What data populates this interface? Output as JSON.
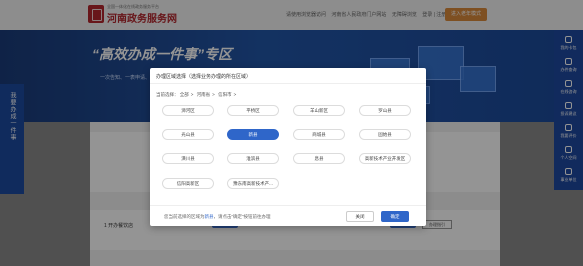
{
  "header": {
    "site_subtitle": "全国一体化在线政务服务平台",
    "site_title": "河南政务服务网",
    "links": [
      "请使用浏览器访问",
      "河南省人民政府门户网站",
      "无障碍浏览",
      "登录 | 注册"
    ],
    "login_button": "进入老年模式"
  },
  "banner": {
    "title": "“高效办成一件事”专区",
    "subtitle": "一次告知、一表申请、一套材料、一次办好"
  },
  "left_float": {
    "text": "我要办成一件事"
  },
  "right_bar": {
    "items": [
      "我的卡包",
      "办件查询",
      "在线咨询",
      "投诉建议",
      "我要评价",
      "个人空间",
      "事业单位"
    ]
  },
  "page": {
    "step_text": "1 开办餐饮店",
    "side_button": "办理指引"
  },
  "modal": {
    "title": "办理区域选择（选择业务办理的所在区域）",
    "breadcrumb": {
      "label": "当前选择：",
      "items": [
        "全部",
        "河南省",
        "信阳市"
      ]
    },
    "chips": [
      "浉河区",
      "平桥区",
      "羊山新区",
      "罗山县",
      "光山县",
      "新县",
      "商城县",
      "固始县",
      "潢川县",
      "淮滨县",
      "息县",
      "高新技术产业开发区",
      "信阳高新区",
      "豫东南高新技术产..."
    ],
    "selected": "新县",
    "note": {
      "prefix": "您当前选择的区域为",
      "value": "新县",
      "suffix": "，请点击“确定”按钮前往办理"
    },
    "cancel": "关闭",
    "confirm": "确定"
  },
  "colors": {
    "accent": "#2f66c9",
    "brand": "#b3272d",
    "banner": "#2256a8"
  }
}
